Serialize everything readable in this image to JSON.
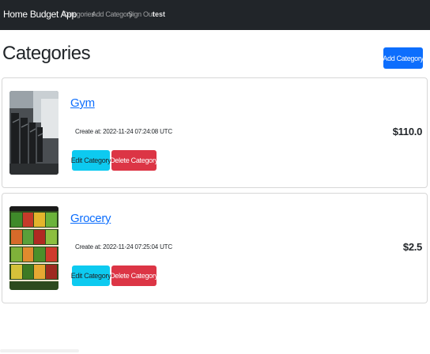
{
  "navbar": {
    "brand": "Home Budget App",
    "links": [
      "Categories",
      "Add Category",
      "Sign Out"
    ],
    "user": "test"
  },
  "page": {
    "title": "Categories",
    "add_button": "Add Category"
  },
  "categories": [
    {
      "name": "Gym",
      "created": "Create at: 2022-11-24 07:24:08 UTC",
      "amount": "$110.0",
      "edit_label": "Edit Category",
      "delete_label": "Delete Category",
      "image_subject": "gym-treadmills-image"
    },
    {
      "name": "Grocery",
      "created": "Create at: 2022-11-24 07:25:04 UTC",
      "amount": "$2.5",
      "edit_label": "Edit Category",
      "delete_label": "Delete Category",
      "image_subject": "grocery-produce-image"
    }
  ],
  "colors": {
    "navbar": "#212529",
    "primary": "#0d6efd",
    "info": "#0dcaf0",
    "danger": "#dc3545"
  }
}
